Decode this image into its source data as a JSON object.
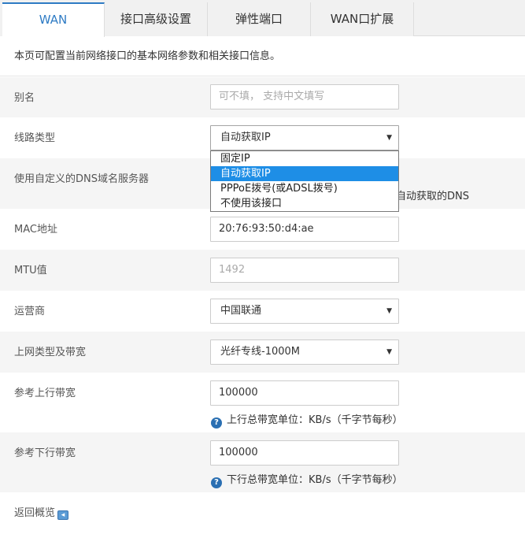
{
  "tabs": [
    "WAN",
    "接口高级设置",
    "弹性端口",
    "WAN口扩展"
  ],
  "description": "本页可配置当前网络接口的基本网络参数和相关接口信息。",
  "alias": {
    "label": "别名",
    "placeholder": "可不填， 支持中文填写"
  },
  "line_type": {
    "label": "线路类型",
    "value": "自动获取IP",
    "options": [
      "固定IP",
      "自动获取IP",
      "PPPoE拨号(或ADSL拨号)",
      "不使用该接口"
    ],
    "selected_index": 1
  },
  "dns": {
    "label": "使用自定义的DNS域名服务器",
    "tail_text": "自动获取的DNS"
  },
  "mac": {
    "label": "MAC地址",
    "value": "20:76:93:50:d4:ae"
  },
  "mtu": {
    "label": "MTU值",
    "value": "1492"
  },
  "isp": {
    "label": "运营商",
    "value": "中国联通"
  },
  "net_type": {
    "label": "上网类型及带宽",
    "value": "光纤专线-1000M"
  },
  "upload": {
    "label": "参考上行带宽",
    "value": "100000",
    "hint": "上行总带宽单位：KB/s（千字节每秒）"
  },
  "download": {
    "label": "参考下行带宽",
    "value": "100000",
    "hint": "下行总带宽单位：KB/s（千字节每秒）"
  },
  "back": {
    "label": "返回概览"
  },
  "colors": {
    "accent": "#2e7bc4",
    "selected_option": "#1e8ee6",
    "row_gray": "#f5f5f5",
    "help_icon": "#2a6fb2"
  }
}
